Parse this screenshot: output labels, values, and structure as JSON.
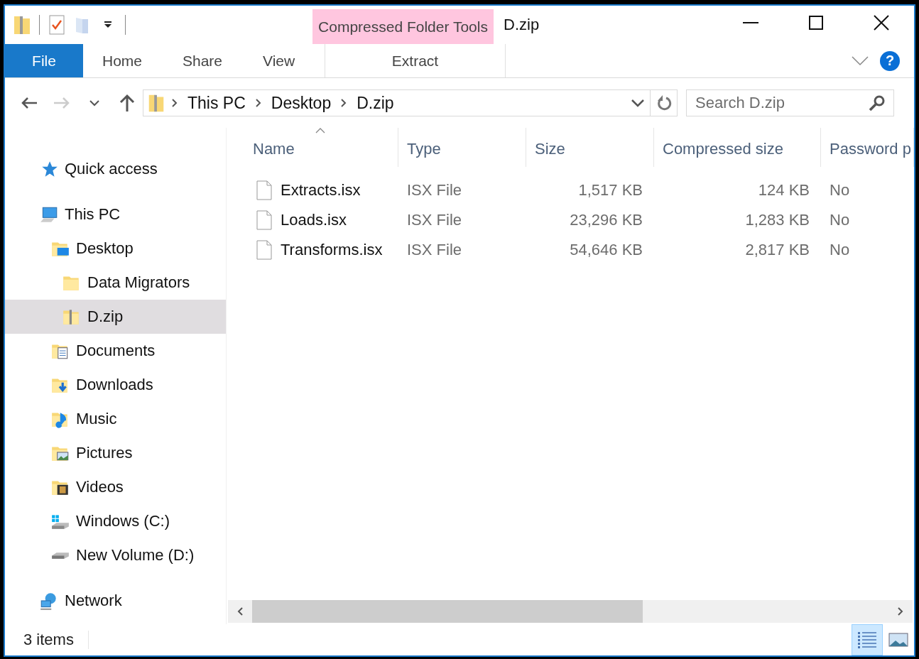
{
  "window": {
    "title": "D.zip",
    "controls": [
      {
        "kind": "minimize"
      },
      {
        "kind": "maximize"
      },
      {
        "kind": "close"
      }
    ]
  },
  "quick_access_toolbar": [
    {
      "kind": "zip"
    },
    {
      "kind": "properties"
    },
    {
      "kind": "new-folder"
    },
    {
      "kind": "customize"
    }
  ],
  "context_header": "Compressed Folder Tools",
  "ribbon_tabs": [
    {
      "label": "File",
      "kind": "file",
      "selected": false
    },
    {
      "label": "Home",
      "kind": "tab",
      "selected": false
    },
    {
      "label": "Share",
      "kind": "tab",
      "selected": false
    },
    {
      "label": "View",
      "kind": "tab",
      "selected": false
    },
    {
      "label": "Extract",
      "kind": "context",
      "selected": false
    }
  ],
  "help": "?",
  "address": {
    "crumbs": [
      "This PC",
      "Desktop",
      "D.zip"
    ]
  },
  "search": {
    "placeholder": "Search D.zip"
  },
  "sidebar": {
    "items": [
      {
        "label": "Quick access",
        "kind": "quick-access",
        "selected": false
      },
      {
        "label": "This PC",
        "kind": "pc",
        "selected": false,
        "children": [
          {
            "label": "Desktop",
            "kind": "desktop",
            "selected": false,
            "children": [
              {
                "label": "Data Migrators",
                "kind": "folder",
                "selected": false
              },
              {
                "label": "D.zip",
                "kind": "zip",
                "selected": true
              }
            ]
          },
          {
            "label": "Documents",
            "kind": "documents",
            "selected": false
          },
          {
            "label": "Downloads",
            "kind": "downloads",
            "selected": false
          },
          {
            "label": "Music",
            "kind": "music",
            "selected": false
          },
          {
            "label": "Pictures",
            "kind": "pictures",
            "selected": false
          },
          {
            "label": "Videos",
            "kind": "videos",
            "selected": false
          },
          {
            "label": "Windows (C:)",
            "kind": "system-drive",
            "selected": false
          },
          {
            "label": "New Volume (D:)",
            "kind": "drive",
            "selected": false
          }
        ]
      },
      {
        "label": "Network",
        "kind": "network",
        "selected": false
      }
    ]
  },
  "table": {
    "columns": [
      "Name",
      "Type",
      "Size",
      "Compressed size",
      "Password p"
    ],
    "rows": [
      {
        "name": "Extracts.isx",
        "type": "ISX File",
        "size": "1,517 KB",
        "compressed_size": "124 KB",
        "password": "No"
      },
      {
        "name": "Loads.isx",
        "type": "ISX File",
        "size": "23,296 KB",
        "compressed_size": "1,283 KB",
        "password": "No"
      },
      {
        "name": "Transforms.isx",
        "type": "ISX File",
        "size": "54,646 KB",
        "compressed_size": "2,817 KB",
        "password": "No"
      }
    ]
  },
  "status_bar": {
    "count": "3 items",
    "view_buttons": [
      {
        "kind": "details",
        "selected": true
      },
      {
        "kind": "large-icons",
        "selected": false
      }
    ]
  }
}
